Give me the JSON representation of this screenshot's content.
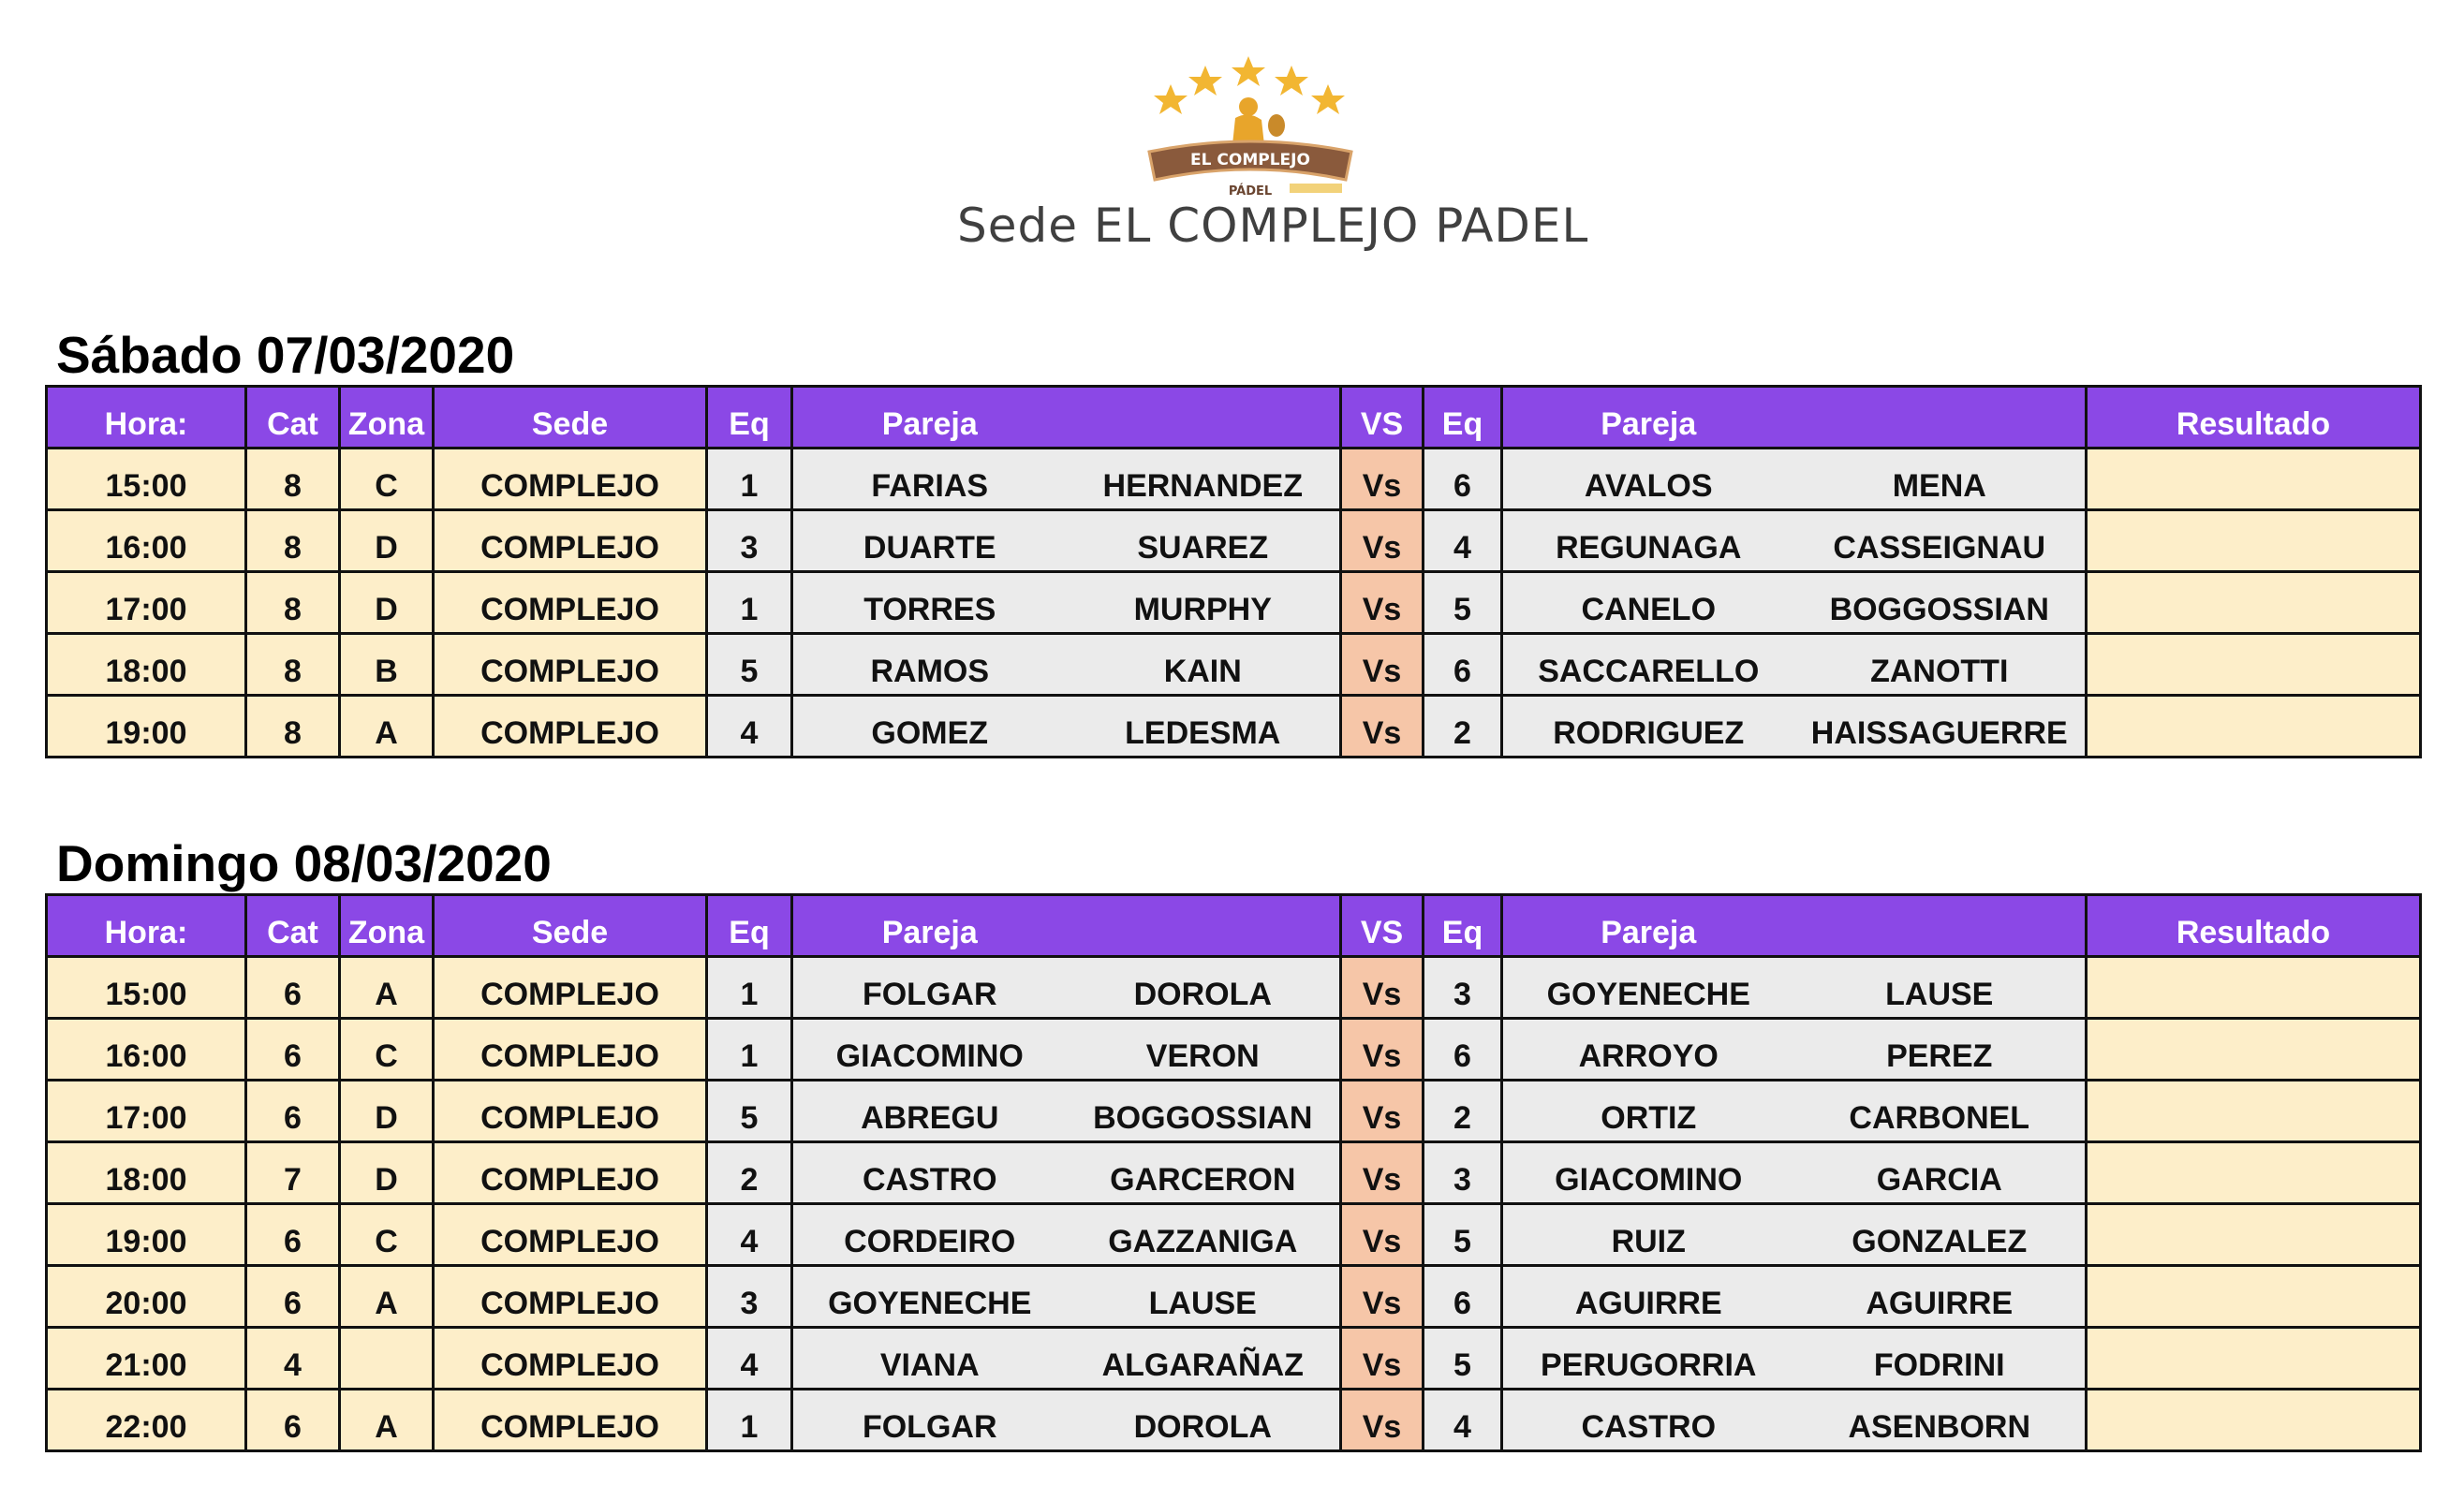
{
  "header": {
    "logo_text_top": "EL COMPLEJO",
    "logo_text_bottom": "PÁDEL",
    "title": "Sede EL COMPLEJO PADEL"
  },
  "columns": {
    "hora": "Hora:",
    "cat": "Cat",
    "zona": "Zona",
    "sede": "Sede",
    "eq": "Eq",
    "pareja": "Pareja",
    "vs": "VS",
    "resultado": "Resultado"
  },
  "colors": {
    "header_purple": "#8b48e6",
    "cream": "#fdeec9",
    "grey": "#ebebeb",
    "salmon": "#f6c6a8",
    "logo_gold": "#f2b632",
    "logo_brown": "#8a5a3c"
  },
  "days": [
    {
      "title": "Sábado 07/03/2020",
      "matches": [
        {
          "hora": "15:00",
          "cat": "8",
          "zona": "C",
          "sede": "COMPLEJO",
          "eq1": "1",
          "p1a": "FARIAS",
          "p1b": "HERNANDEZ",
          "vs": "Vs",
          "eq2": "6",
          "p2a": "AVALOS",
          "p2b": "MENA",
          "resultado": ""
        },
        {
          "hora": "16:00",
          "cat": "8",
          "zona": "D",
          "sede": "COMPLEJO",
          "eq1": "3",
          "p1a": "DUARTE",
          "p1b": "SUAREZ",
          "vs": "Vs",
          "eq2": "4",
          "p2a": "REGUNAGA",
          "p2b": "CASSEIGNAU",
          "resultado": ""
        },
        {
          "hora": "17:00",
          "cat": "8",
          "zona": "D",
          "sede": "COMPLEJO",
          "eq1": "1",
          "p1a": "TORRES",
          "p1b": "MURPHY",
          "vs": "Vs",
          "eq2": "5",
          "p2a": "CANELO",
          "p2b": "BOGGOSSIAN",
          "resultado": ""
        },
        {
          "hora": "18:00",
          "cat": "8",
          "zona": "B",
          "sede": "COMPLEJO",
          "eq1": "5",
          "p1a": "RAMOS",
          "p1b": "KAIN",
          "vs": "Vs",
          "eq2": "6",
          "p2a": "SACCARELLO",
          "p2b": "ZANOTTI",
          "resultado": ""
        },
        {
          "hora": "19:00",
          "cat": "8",
          "zona": "A",
          "sede": "COMPLEJO",
          "eq1": "4",
          "p1a": "GOMEZ",
          "p1b": "LEDESMA",
          "vs": "Vs",
          "eq2": "2",
          "p2a": "RODRIGUEZ",
          "p2b": "HAISSAGUERRE",
          "resultado": ""
        }
      ]
    },
    {
      "title": "Domingo 08/03/2020",
      "matches": [
        {
          "hora": "15:00",
          "cat": "6",
          "zona": "A",
          "sede": "COMPLEJO",
          "eq1": "1",
          "p1a": "FOLGAR",
          "p1b": "DOROLA",
          "vs": "Vs",
          "eq2": "3",
          "p2a": "GOYENECHE",
          "p2b": "LAUSE",
          "resultado": ""
        },
        {
          "hora": "16:00",
          "cat": "6",
          "zona": "C",
          "sede": "COMPLEJO",
          "eq1": "1",
          "p1a": "GIACOMINO",
          "p1b": "VERON",
          "vs": "Vs",
          "eq2": "6",
          "p2a": "ARROYO",
          "p2b": "PEREZ",
          "resultado": ""
        },
        {
          "hora": "17:00",
          "cat": "6",
          "zona": "D",
          "sede": "COMPLEJO",
          "eq1": "5",
          "p1a": "ABREGU",
          "p1b": "BOGGOSSIAN",
          "vs": "Vs",
          "eq2": "2",
          "p2a": "ORTIZ",
          "p2b": "CARBONEL",
          "resultado": ""
        },
        {
          "hora": "18:00",
          "cat": "7",
          "zona": "D",
          "sede": "COMPLEJO",
          "eq1": "2",
          "p1a": "CASTRO",
          "p1b": "GARCERON",
          "vs": "Vs",
          "eq2": "3",
          "p2a": "GIACOMINO",
          "p2b": "GARCIA",
          "resultado": ""
        },
        {
          "hora": "19:00",
          "cat": "6",
          "zona": "C",
          "sede": "COMPLEJO",
          "eq1": "4",
          "p1a": "CORDEIRO",
          "p1b": "GAZZANIGA",
          "vs": "Vs",
          "eq2": "5",
          "p2a": "RUIZ",
          "p2b": "GONZALEZ",
          "resultado": ""
        },
        {
          "hora": "20:00",
          "cat": "6",
          "zona": "A",
          "sede": "COMPLEJO",
          "eq1": "3",
          "p1a": "GOYENECHE",
          "p1b": "LAUSE",
          "vs": "Vs",
          "eq2": "6",
          "p2a": "AGUIRRE",
          "p2b": "AGUIRRE",
          "resultado": ""
        },
        {
          "hora": "21:00",
          "cat": "4",
          "zona": "",
          "sede": "COMPLEJO",
          "eq1": "4",
          "p1a": "VIANA",
          "p1b": "ALGARAÑAZ",
          "vs": "Vs",
          "eq2": "5",
          "p2a": "PERUGORRIA",
          "p2b": "FODRINI",
          "resultado": ""
        },
        {
          "hora": "22:00",
          "cat": "6",
          "zona": "A",
          "sede": "COMPLEJO",
          "eq1": "1",
          "p1a": "FOLGAR",
          "p1b": "DOROLA",
          "vs": "Vs",
          "eq2": "4",
          "p2a": "CASTRO",
          "p2b": "ASENBORN",
          "resultado": ""
        }
      ]
    }
  ]
}
